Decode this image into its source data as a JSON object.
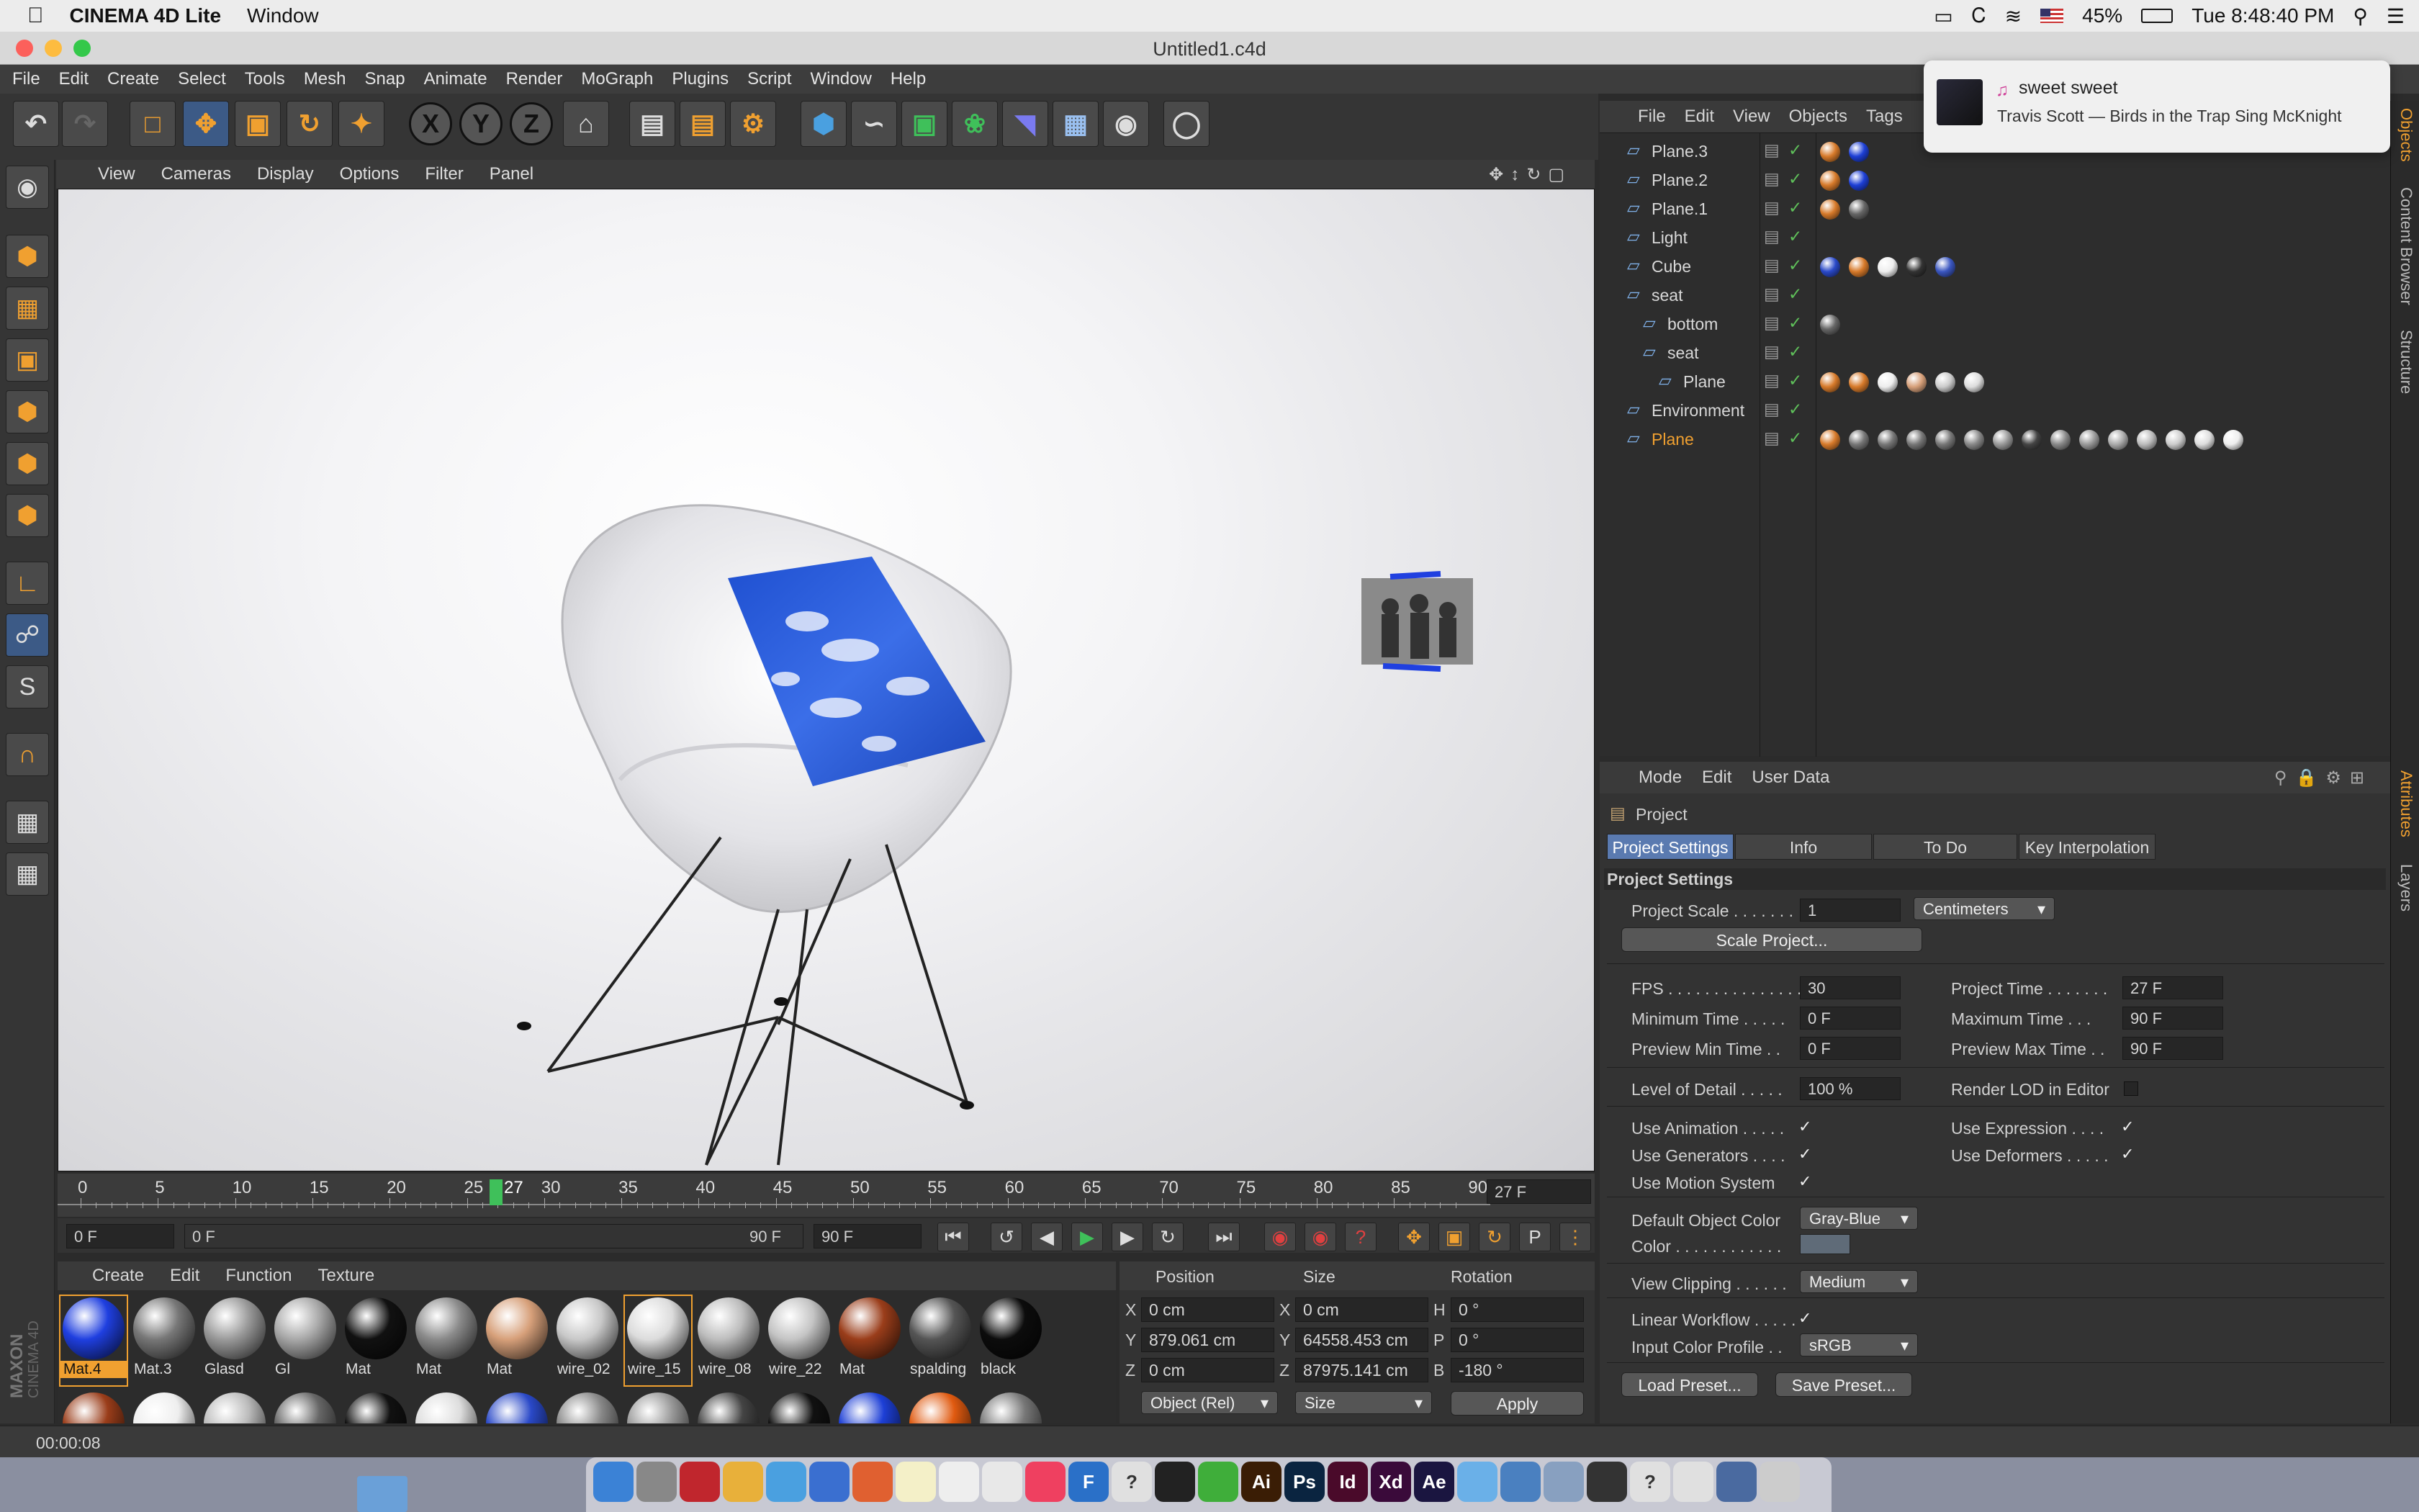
{
  "macbar": {
    "app_name": "CINEMA 4D Lite",
    "menu": [
      "Window"
    ],
    "battery": "45%",
    "clock": "Tue 8:48:40 PM"
  },
  "window": {
    "title": "Untitled1.c4d"
  },
  "app_menu": [
    "File",
    "Edit",
    "Create",
    "Select",
    "Tools",
    "Mesh",
    "Snap",
    "Animate",
    "Render",
    "MoGraph",
    "Plugins",
    "Script",
    "Window",
    "Help"
  ],
  "toolbar": {
    "axis_x": "X",
    "axis_y": "Y",
    "axis_z": "Z"
  },
  "viewport": {
    "menu": [
      "View",
      "Cameras",
      "Display",
      "Options",
      "Filter",
      "Panel"
    ]
  },
  "timeline": {
    "ticks": [
      "0",
      "5",
      "10",
      "15",
      "20",
      "25",
      "30",
      "35",
      "40",
      "45",
      "50",
      "55",
      "60",
      "65",
      "70",
      "75",
      "80",
      "85",
      "90"
    ],
    "current": "27",
    "current_field": "27 F",
    "start_field": "0 F",
    "range_start": "0 F",
    "range_end": "90 F",
    "end_field": "90 F"
  },
  "materials": {
    "menu": [
      "Create",
      "Edit",
      "Function",
      "Texture"
    ],
    "items": [
      {
        "label": "Mat.4",
        "color": "#1f3fe0"
      },
      {
        "label": "Mat.3",
        "color": "#777777"
      },
      {
        "label": "Glasd",
        "color": "#9a9a9a"
      },
      {
        "label": "Gl",
        "color": "#a8a8a8"
      },
      {
        "label": "Mat",
        "color": "#111111"
      },
      {
        "label": "Mat",
        "color": "#8a8a8a"
      },
      {
        "label": "Mat",
        "color": "#d7a07a"
      },
      {
        "label": "wire_02",
        "color": "#c8c8c8"
      },
      {
        "label": "wire_15",
        "color": "#dcdcdc"
      },
      {
        "label": "wire_08",
        "color": "#bdbdbd"
      },
      {
        "label": "wire_22",
        "color": "#c4c4c4"
      },
      {
        "label": "Mat",
        "color": "#9a3d1a"
      },
      {
        "label": "spalding",
        "color": "#555555"
      },
      {
        "label": "black",
        "color": "#0c0c0c"
      }
    ]
  },
  "coordinates": {
    "headers": [
      "Position",
      "Size",
      "Rotation"
    ],
    "rows": [
      {
        "axis": "X",
        "pos": "0 cm",
        "size_axis": "X",
        "size": "0 cm",
        "rot_axis": "H",
        "rot": "0 °"
      },
      {
        "axis": "Y",
        "pos": "879.061 cm",
        "size_axis": "Y",
        "size": "64558.453 cm",
        "rot_axis": "P",
        "rot": "0 °"
      },
      {
        "axis": "Z",
        "pos": "0 cm",
        "size_axis": "Z",
        "size": "87975.141 cm",
        "rot_axis": "B",
        "rot": "-180 °"
      }
    ],
    "mode": "Object (Rel)",
    "size_mode": "Size",
    "apply": "Apply"
  },
  "status": {
    "text": "00:00:08"
  },
  "object_manager": {
    "menu": [
      "File",
      "Edit",
      "View",
      "Objects",
      "Tags"
    ],
    "rows": [
      {
        "name": "Plane.3",
        "indent": 0,
        "tags": [
          "#d77a2a",
          "#1d3fd6"
        ]
      },
      {
        "name": "Plane.2",
        "indent": 0,
        "tags": [
          "#d77a2a",
          "#1d3fd6"
        ]
      },
      {
        "name": "Plane.1",
        "indent": 0,
        "tags": [
          "#d77a2a",
          "#666666"
        ]
      },
      {
        "name": "Light",
        "indent": 0,
        "tags": []
      },
      {
        "name": "Cube",
        "indent": 0,
        "tags": [
          "#2a49c8",
          "#d77a2a",
          "#eeeeee",
          "#333333",
          "#3a56c0"
        ]
      },
      {
        "name": "seat",
        "indent": 0,
        "tags": []
      },
      {
        "name": "bottom",
        "indent": 1,
        "tags": [
          "#666666"
        ]
      },
      {
        "name": "seat",
        "indent": 1,
        "tags": []
      },
      {
        "name": "Plane",
        "indent": 2,
        "tags": [
          "#d77a2a",
          "#d77a2a",
          "#eeeeee",
          "#d7a07a",
          "#cccccc",
          "#dddddd"
        ]
      },
      {
        "name": "Environment",
        "indent": 0,
        "tags": []
      },
      {
        "name": "Plane",
        "indent": 0,
        "tags": [
          "#d77a2a",
          "#777",
          "#777",
          "#777",
          "#777",
          "#888",
          "#999",
          "#444",
          "#888",
          "#999",
          "#aaa",
          "#bbb",
          "#ccc",
          "#ddd",
          "#eee"
        ]
      }
    ]
  },
  "attributes": {
    "menu": [
      "Mode",
      "Edit",
      "User Data"
    ],
    "object": "Project",
    "tabs": [
      "Project Settings",
      "Info",
      "To Do",
      "Key Interpolation"
    ],
    "section": "Project Settings",
    "project_scale_label": "Project Scale . . . . . . .",
    "project_scale": "1",
    "scale_unit": "Centimeters",
    "scale_button": "Scale Project...",
    "fps_label": "FPS . . . . . . . . . . . . . . .",
    "fps": "30",
    "project_time_label": "Project Time . . . . . . .",
    "project_time": "27 F",
    "min_time_label": "Minimum Time . . . . .",
    "min_time": "0 F",
    "max_time_label": "Maximum Time . . .",
    "max_time": "90 F",
    "prev_min_label": "Preview Min Time . .",
    "prev_min": "0 F",
    "prev_max_label": "Preview Max Time . .",
    "prev_max": "90 F",
    "lod_label": "Level of Detail . . . . .",
    "lod": "100 %",
    "render_lod_label": "Render LOD in Editor",
    "use_animation": "Use Animation . . . . .",
    "use_expression": "Use Expression . . . .",
    "use_generators": "Use Generators . . . .",
    "use_deformers": "Use Deformers . . . . .",
    "use_motion": "Use Motion System",
    "default_color_label": "Default Object Color",
    "default_color": "Gray-Blue",
    "color_label": "Color . . . . . . . . . . . .",
    "view_clipping_label": "View Clipping . . . . . .",
    "view_clipping": "Medium",
    "linear_workflow": "Linear Workflow . . . . .",
    "input_profile_label": "Input Color Profile . .",
    "input_profile": "sRGB",
    "load_preset": "Load Preset...",
    "save_preset": "Save Preset..."
  },
  "side_tabs": {
    "right_top": [
      "Objects",
      "Content Browser",
      "Structure"
    ],
    "right_bottom": [
      "Attributes",
      "Layers"
    ]
  },
  "notification": {
    "title": "sweet sweet",
    "subtitle": "Travis Scott — Birds in the Trap Sing McKnight"
  },
  "dock": [
    {
      "label": "",
      "color": "#3b82d6"
    },
    {
      "label": "",
      "color": "#888"
    },
    {
      "label": "",
      "color": "#c0262d"
    },
    {
      "label": "",
      "color": "#e8b03a"
    },
    {
      "label": "",
      "color": "#4aa0e0"
    },
    {
      "label": "",
      "color": "#3a6fd0"
    },
    {
      "label": "",
      "color": "#e06030"
    },
    {
      "label": "",
      "color": "#f4f0c8"
    },
    {
      "label": "",
      "color": "#eeeeee"
    },
    {
      "label": "",
      "color": "#e8e8e8"
    },
    {
      "label": "",
      "color": "#ef4060"
    },
    {
      "label": "F",
      "color": "#2a70c8"
    },
    {
      "label": "?",
      "color": "#e0e0e0"
    },
    {
      "label": "",
      "color": "#222"
    },
    {
      "label": "",
      "color": "#3fae3a"
    },
    {
      "label": "Ai",
      "color": "#3a1d05"
    },
    {
      "label": "Ps",
      "color": "#0a2440"
    },
    {
      "label": "Id",
      "color": "#4a0a2a"
    },
    {
      "label": "Xd",
      "color": "#3a0a3a"
    },
    {
      "label": "Ae",
      "color": "#1a1540"
    },
    {
      "label": "",
      "color": "#6ab0e8"
    },
    {
      "label": "",
      "color": "#4a80c0"
    },
    {
      "label": "",
      "color": "#88a0c0"
    },
    {
      "label": "",
      "color": "#333"
    },
    {
      "label": "?",
      "color": "#e0e0e0"
    },
    {
      "label": "",
      "color": "#e0e0e0"
    },
    {
      "label": "",
      "color": "#4a6aa0"
    },
    {
      "label": "",
      "color": "#cccccc"
    }
  ]
}
